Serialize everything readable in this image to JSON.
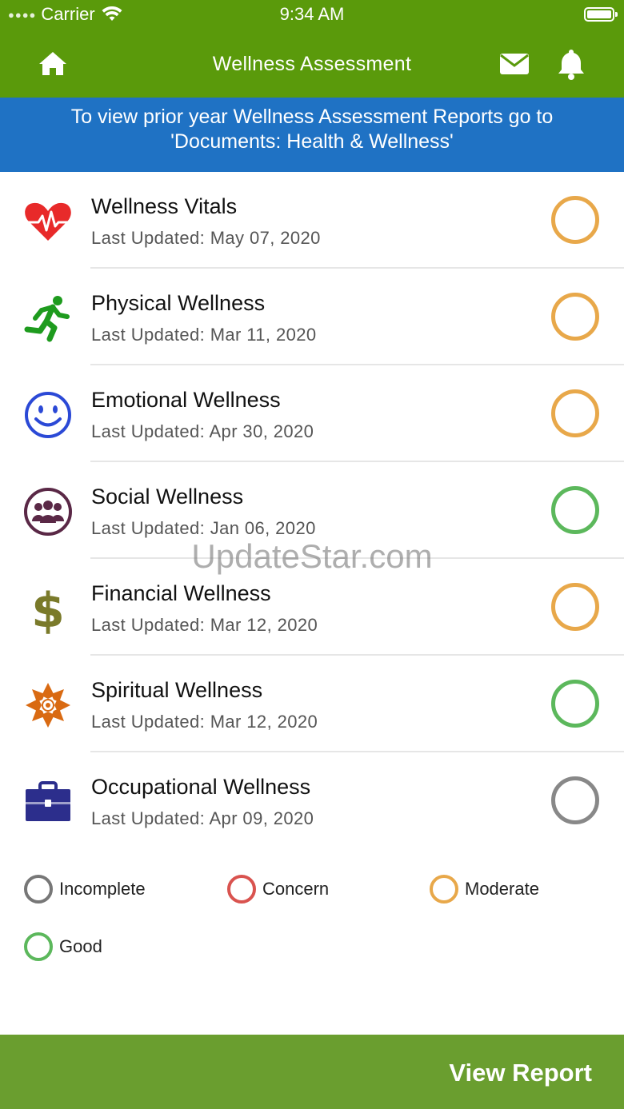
{
  "status_bar": {
    "carrier": "Carrier",
    "time": "9:34 AM"
  },
  "nav": {
    "title": "Wellness  Assessment"
  },
  "banner": {
    "line1": "To view prior year Wellness Assessment Reports go to",
    "line2": "'Documents: Health & Wellness'"
  },
  "assessments": [
    {
      "title": "Wellness Vitals",
      "updated": "Last Updated: May 07, 2020",
      "status": "Moderate",
      "status_color": "#e8a84a",
      "icon": "heart-pulse-icon",
      "icon_color": "#e82a2a"
    },
    {
      "title": "Physical Wellness",
      "updated": "Last Updated: Mar 11, 2020",
      "status": "Moderate",
      "status_color": "#e8a84a",
      "icon": "running-person-icon",
      "icon_color": "#1e9b1e"
    },
    {
      "title": "Emotional Wellness",
      "updated": "Last Updated: Apr 30, 2020",
      "status": "Moderate",
      "status_color": "#e8a84a",
      "icon": "smiley-face-icon",
      "icon_color": "#2b49d6"
    },
    {
      "title": "Social Wellness",
      "updated": "Last Updated: Jan 06, 2020",
      "status": "Good",
      "status_color": "#5cb85c",
      "icon": "people-group-icon",
      "icon_color": "#5a2846"
    },
    {
      "title": "Financial Wellness",
      "updated": "Last Updated: Mar 12, 2020",
      "status": "Moderate",
      "status_color": "#e8a84a",
      "icon": "dollar-sign-icon",
      "icon_color": "#7a7a2a"
    },
    {
      "title": "Spiritual Wellness",
      "updated": "Last Updated: Mar 12, 2020",
      "status": "Good",
      "status_color": "#5cb85c",
      "icon": "mandala-flower-icon",
      "icon_color": "#d96a12"
    },
    {
      "title": "Occupational Wellness",
      "updated": "Last Updated: Apr 09, 2020",
      "status": "Incomplete",
      "status_color": "#888888",
      "icon": "briefcase-icon",
      "icon_color": "#2c2e8c"
    }
  ],
  "legend": [
    {
      "label": "Incomplete",
      "color": "#777777"
    },
    {
      "label": "Concern",
      "color": "#d9534f"
    },
    {
      "label": "Moderate",
      "color": "#e8a84a"
    },
    {
      "label": "Good",
      "color": "#5cb85c"
    }
  ],
  "footer": {
    "button_label": "View Report"
  },
  "watermark": "UpdateStar.com",
  "colors": {
    "header_green": "#5a9a0b",
    "banner_blue": "#1f72c4",
    "footer_green": "#6a9e2f"
  }
}
